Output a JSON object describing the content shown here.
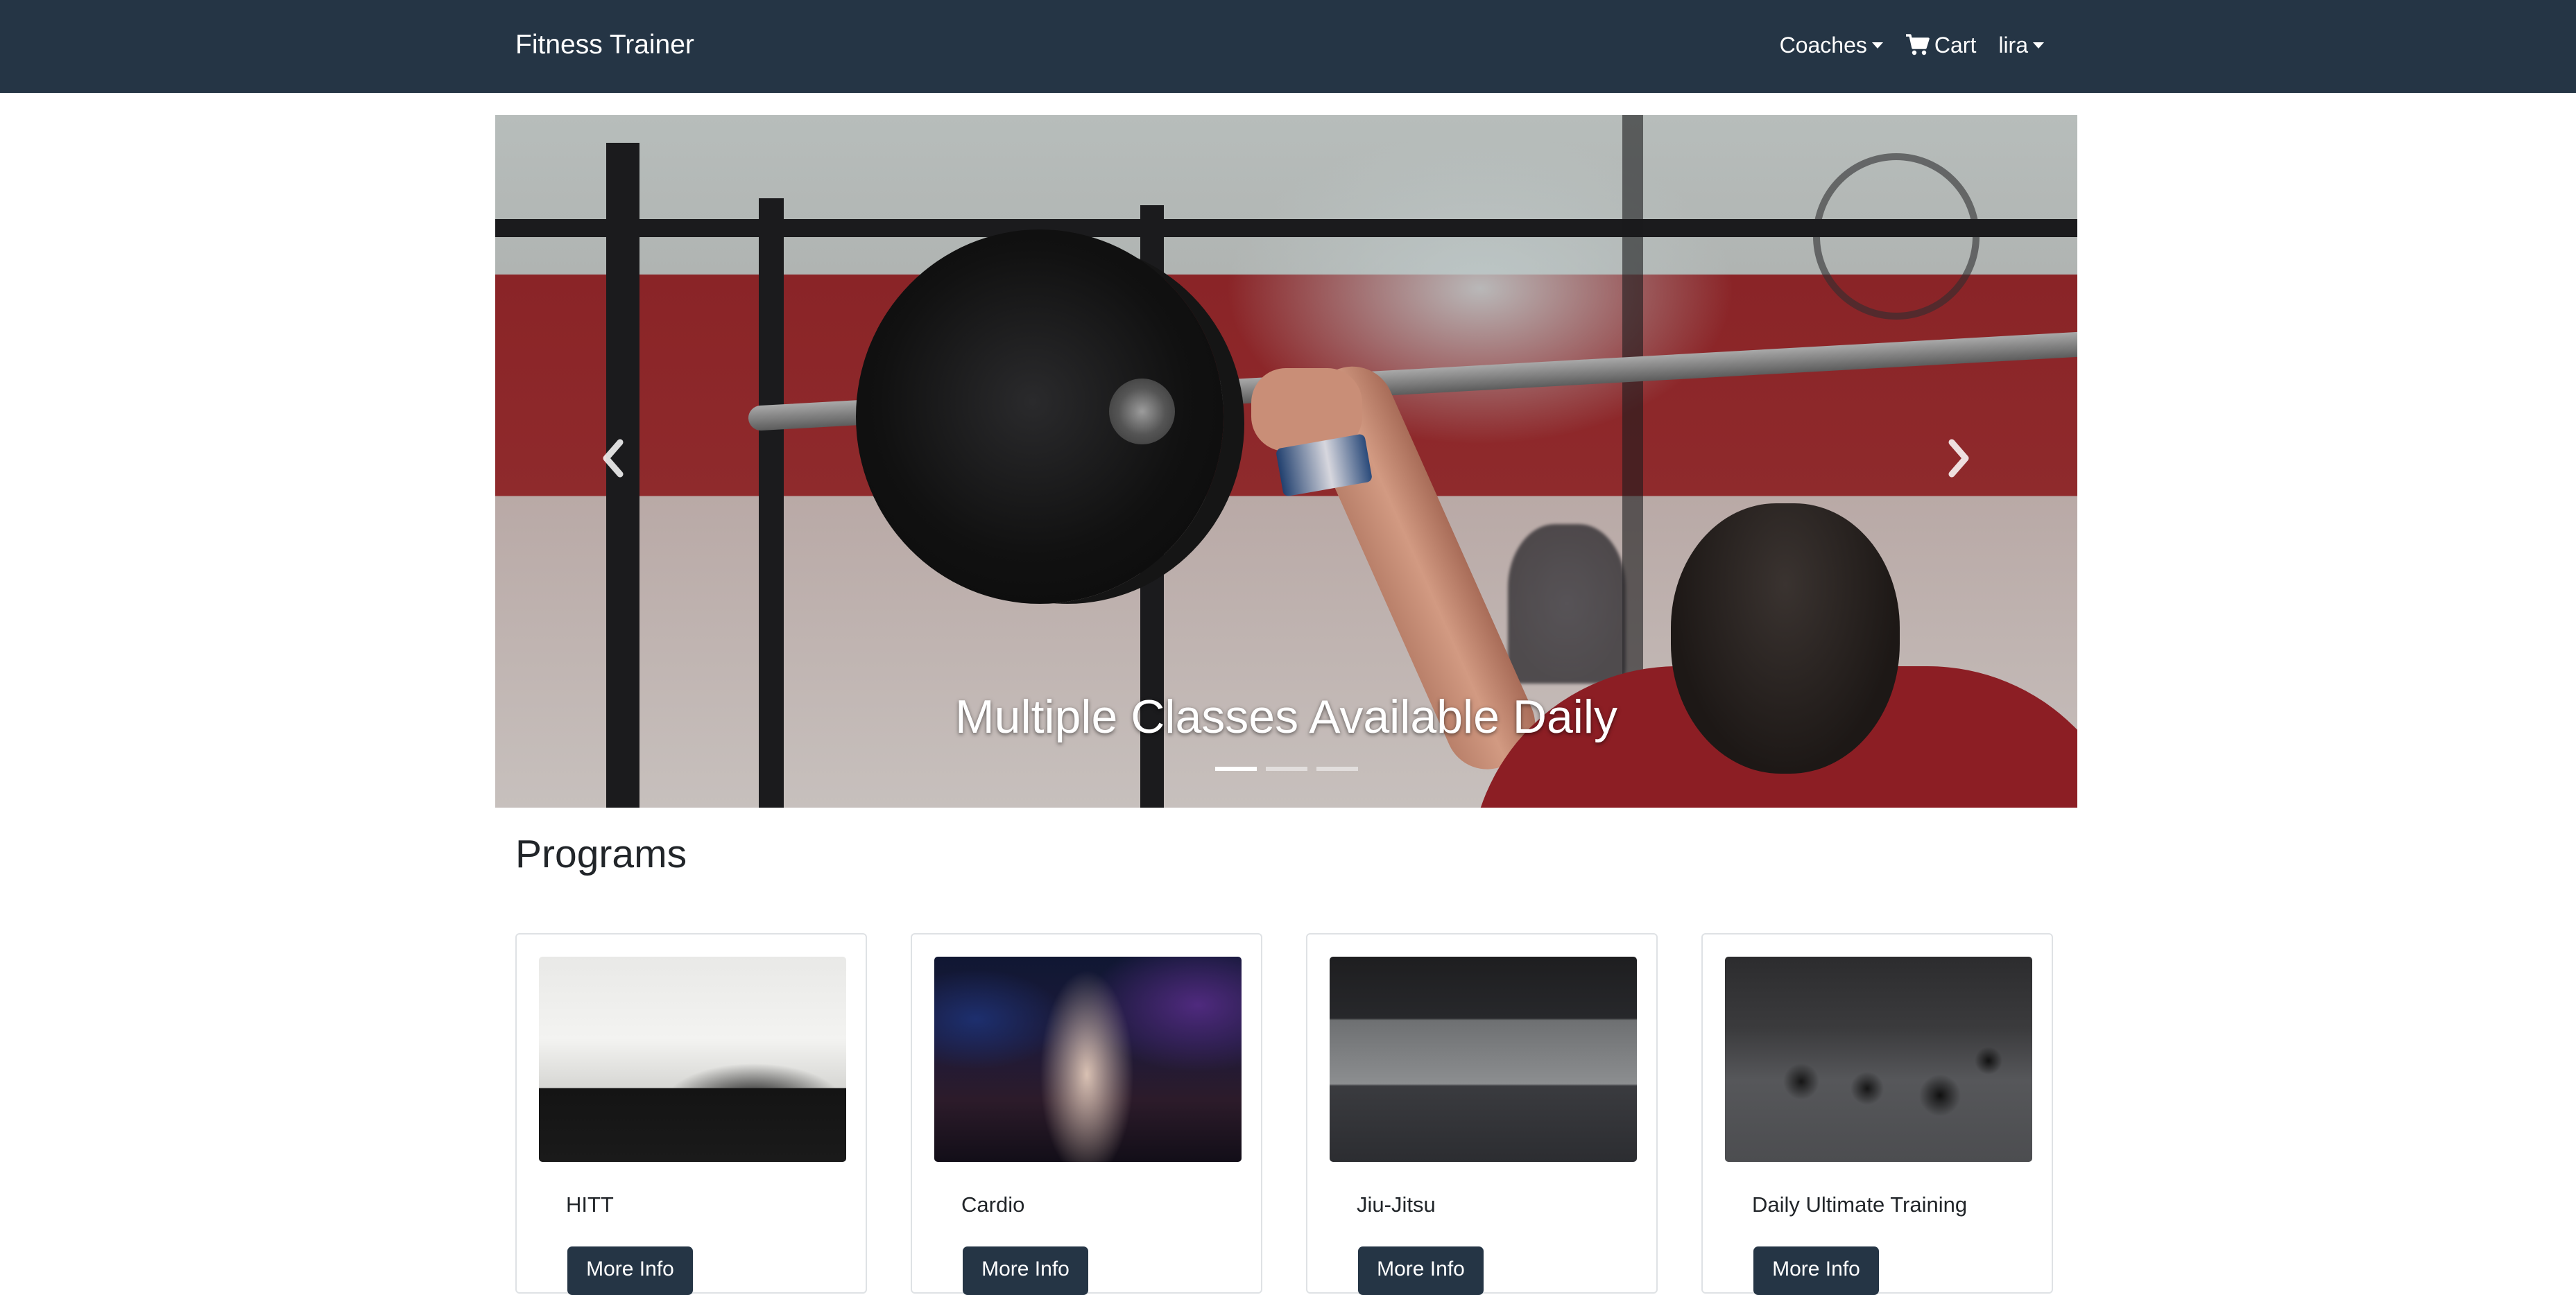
{
  "navbar": {
    "brand": "Fitness Trainer",
    "coaches_label": "Coaches",
    "cart_label": "Cart",
    "user_label": "lira"
  },
  "carousel": {
    "caption": "Multiple Classes Available Daily",
    "slide_count": 3,
    "active_slide": 1
  },
  "programs": {
    "heading": "Programs",
    "cards": [
      {
        "title": "HITT",
        "button": "More Info"
      },
      {
        "title": "Cardio",
        "button": "More Info"
      },
      {
        "title": "Jiu-Jitsu",
        "button": "More Info"
      },
      {
        "title": "Daily Ultimate Training",
        "button": "More Info"
      }
    ]
  },
  "colors": {
    "navbar_bg": "#253545",
    "button_bg": "#253545",
    "text": "#212529"
  },
  "icons": [
    "shopping-cart-icon",
    "chevron-left-icon",
    "chevron-right-icon",
    "caret-down-icon"
  ]
}
